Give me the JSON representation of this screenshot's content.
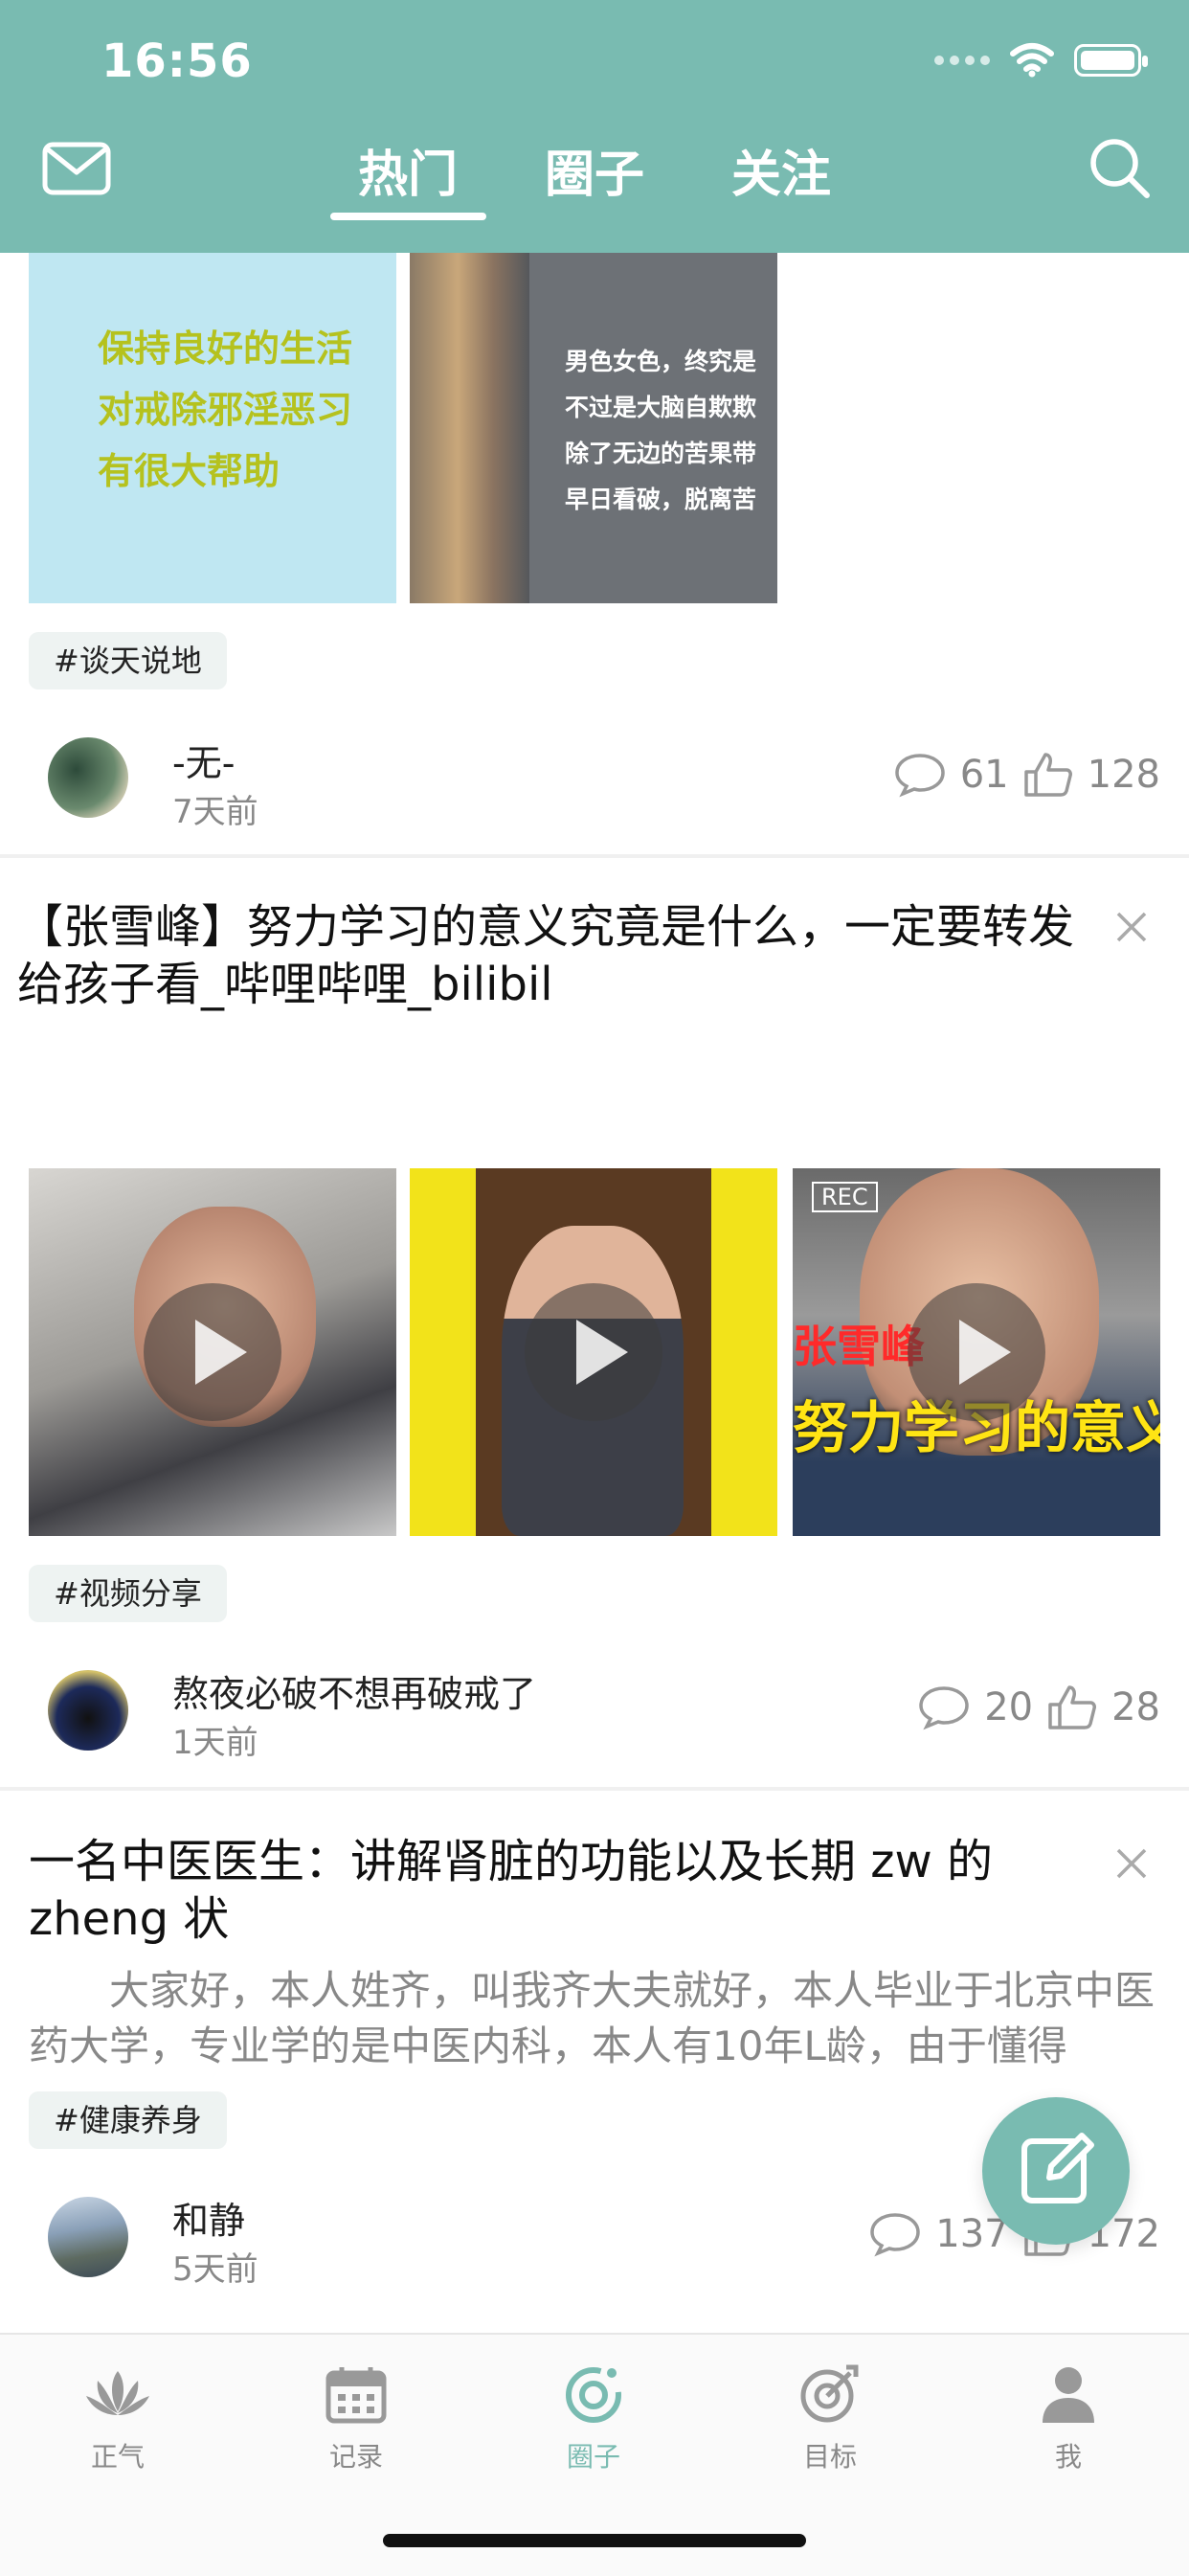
{
  "status": {
    "time": "16:56"
  },
  "header": {
    "tabs": [
      {
        "label": "热门",
        "active": true
      },
      {
        "label": "圈子",
        "active": false
      },
      {
        "label": "关注",
        "active": false
      }
    ],
    "accent": "#79bbb1"
  },
  "posts": [
    {
      "images": [
        {
          "text_lines": [
            "保持良好的生活",
            "对戒除邪淫恶习",
            "有很大帮助"
          ]
        },
        {
          "text_lines": [
            "男色女色，终究是",
            "不过是大脑自欺欺",
            "除了无边的苦果带",
            "早日看破，脱离苦"
          ]
        }
      ],
      "tag": "#谈天说地",
      "user": "-无-",
      "time": "7天前",
      "comments": "61",
      "likes": "128"
    },
    {
      "title": "【张雪峰】努力学习的意义究竟是什么，一定要转发给孩子看_哔哩哔哩_bilibil",
      "video_overlays": [
        "REC",
        "张雪峰",
        "努力学习的意义"
      ],
      "tag": "#视频分享",
      "user": "熬夜必破不想再破戒了",
      "time": "1天前",
      "comments": "20",
      "likes": "28"
    },
    {
      "title": "一名中医医生：讲解肾脏的功能以及长期 zw 的 zheng 状",
      "excerpt": "大家好，本人姓齐，叫我齐大夫就好，本人毕业于北京中医药大学，专业学的是中医内科，本人有10年L龄，由于懂得",
      "tag": "#健康养身",
      "user": "和静",
      "time": "5天前",
      "comments": "137",
      "likes": "172"
    }
  ],
  "bottom_nav": [
    {
      "label": "正气",
      "icon": "lotus-icon",
      "active": false
    },
    {
      "label": "记录",
      "icon": "calendar-icon",
      "active": false
    },
    {
      "label": "圈子",
      "icon": "circle-icon",
      "active": true
    },
    {
      "label": "目标",
      "icon": "target-icon",
      "active": false
    },
    {
      "label": "我",
      "icon": "person-icon",
      "active": false
    }
  ]
}
